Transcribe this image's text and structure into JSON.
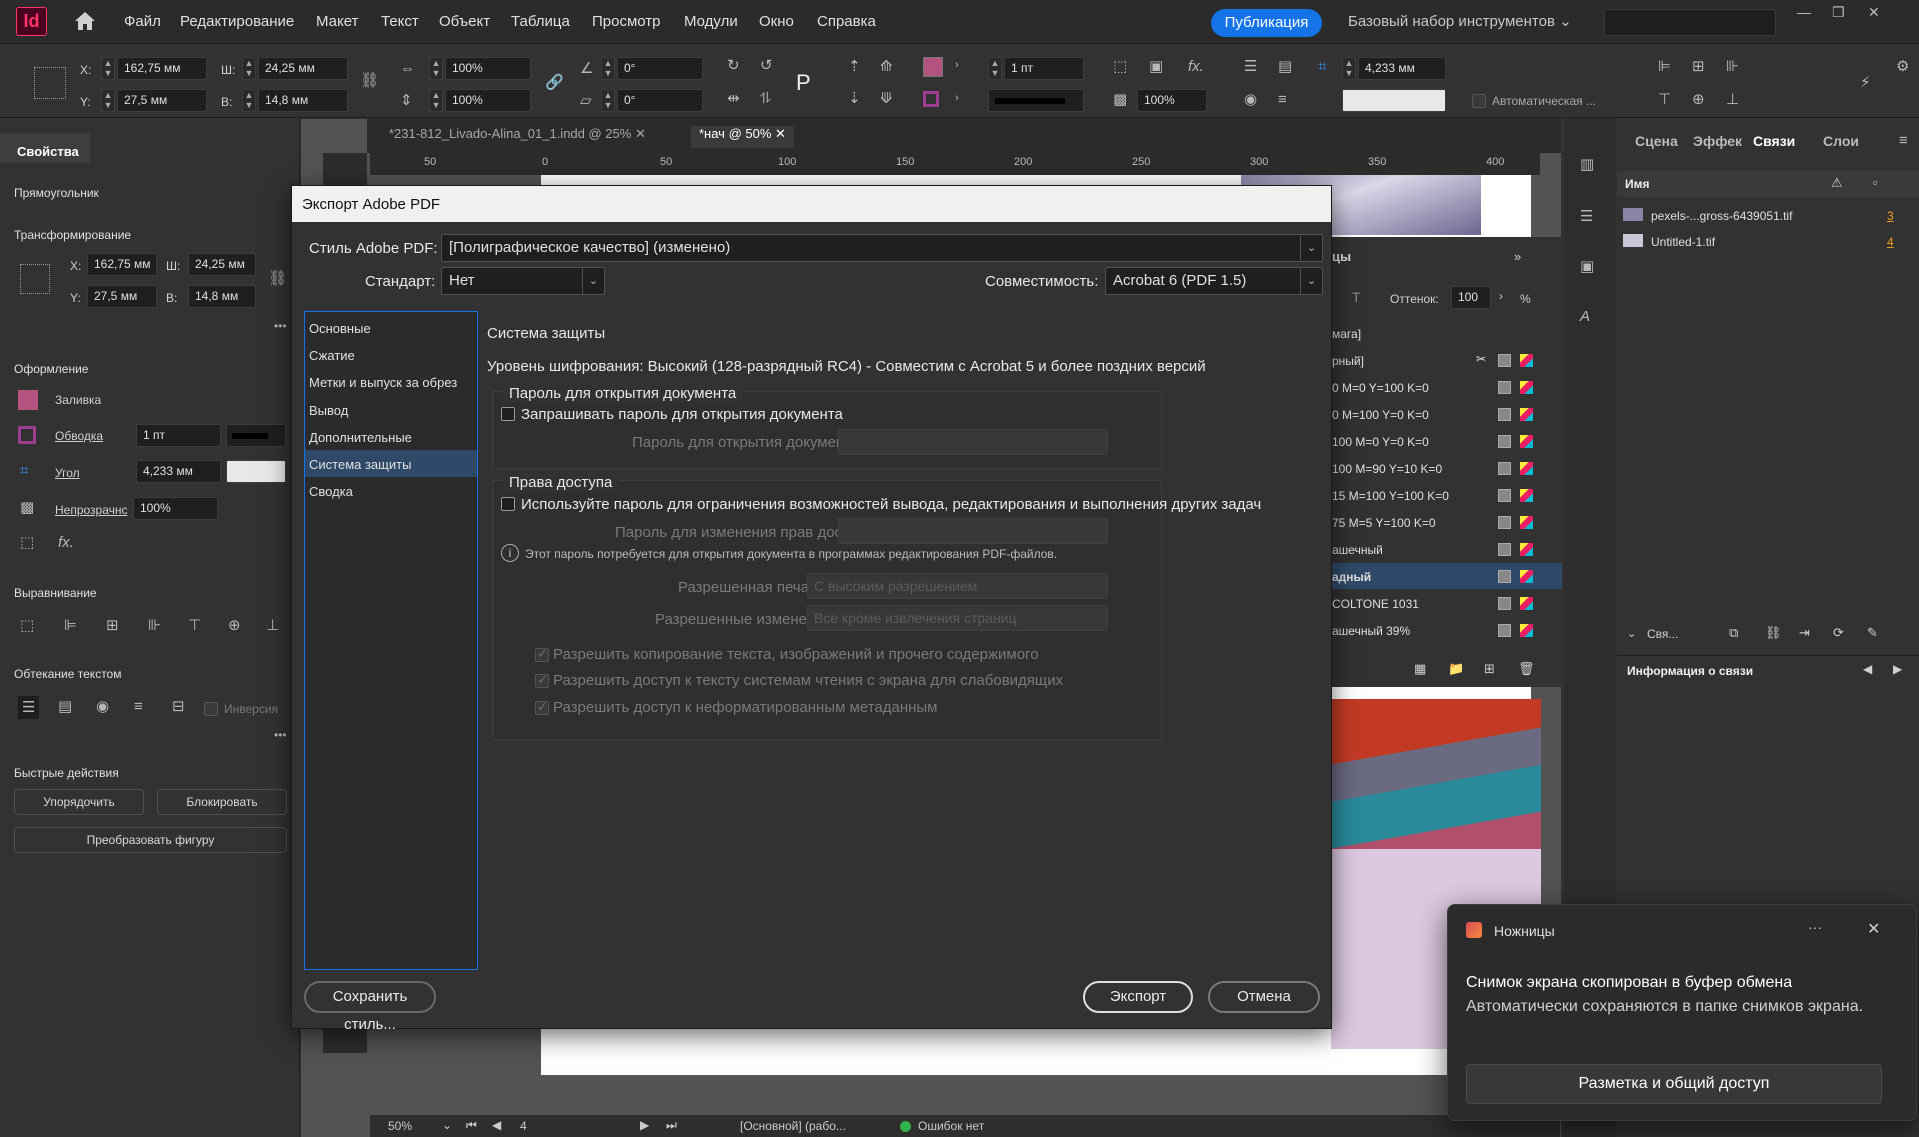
{
  "menubar": {
    "logo": "Id",
    "items": [
      "Файл",
      "Редактирование",
      "Макет",
      "Текст",
      "Объект",
      "Таблица",
      "Просмотр",
      "Модули",
      "Окно",
      "Справка"
    ],
    "publish": "Публикация",
    "workspace": "Базовый набор инструментов"
  },
  "control": {
    "x_label": "X:",
    "x": "162,75 мм",
    "y_label": "Y:",
    "y": "27,5 мм",
    "w_label": "Ш:",
    "w": "24,25 мм",
    "h_label": "В:",
    "h": "14,8 мм",
    "scale_x": "100%",
    "scale_y": "100%",
    "rotate": "0°",
    "shear": "0°",
    "stroke_weight": "1 пт",
    "opacity": "100%",
    "offset": "4,233 мм",
    "auto_label": "Автоматическая ..."
  },
  "left_panel": {
    "tab": "Свойства",
    "object_type": "Прямоугольник",
    "transform_title": "Трансформирование",
    "x_label": "X:",
    "x": "162,75 мм",
    "y_label": "Y:",
    "y": "27,5 мм",
    "w_label": "Ш:",
    "w": "24,25 мм",
    "h_label": "В:",
    "h": "14,8 мм",
    "appearance_title": "Оформление",
    "fill_label": "Заливка",
    "stroke_label": "Обводка",
    "stroke_weight": "1 пт",
    "corner_label": "Угол",
    "corner_value": "4,233 мм",
    "opacity_label": "Непрозрачнс",
    "opacity_value": "100%",
    "align_title": "Выравнивание",
    "wrap_title": "Обтекание текстом",
    "invert_label": "Инверсия",
    "quick_title": "Быстрые действия",
    "arrange_btn": "Упорядочить",
    "lock_btn": "Блокировать",
    "convert_btn": "Преобразовать фигуру",
    "fill_color": "#b3537f",
    "stroke_color": "#9b3e8f"
  },
  "tabs": [
    {
      "label": "*231-812_Livado-Alina_01_1.indd @ 25%"
    },
    {
      "label": "*нач @ 50%"
    }
  ],
  "ruler": [
    "50",
    "0",
    "50",
    "100",
    "150",
    "200",
    "250",
    "300",
    "350",
    "400"
  ],
  "swatches": {
    "tab": "цы",
    "tint_label": "Оттенок:",
    "tint": "100",
    "pct": "%",
    "rows": [
      "мага]",
      "рный]",
      "0 M=0 Y=100 K=0",
      "0 M=100 Y=0 K=0",
      "100 M=0 Y=0 K=0",
      "100 M=90 Y=10 K=0",
      "15 M=100 Y=100 K=0",
      "75 M=5 Y=100 K=0",
      "ашечный",
      "адный",
      "COLTONE 1031",
      "ашечный 39%"
    ]
  },
  "right_panel": {
    "tabs": [
      "Сцена",
      "Эффек",
      "Связи",
      "Слои"
    ],
    "col_name": "Имя",
    "links": [
      {
        "name": "pexels-...gross-6439051.tif",
        "page": "3"
      },
      {
        "name": "Untitled-1.tif",
        "page": "4"
      }
    ],
    "footer_label": "Свя...",
    "info_label": "Информация о связи"
  },
  "status": {
    "zoom": "50%",
    "page": "4",
    "master": "[Основной] (рабо...",
    "errors": "Ошибок нет"
  },
  "dialog": {
    "title": "Экспорт Adobe PDF",
    "style_label": "Стиль Adobe PDF:",
    "style_value": "[Полиграфическое качество] (изменено)",
    "standard_label": "Стандарт:",
    "standard_value": "Нет",
    "compat_label": "Совместимость:",
    "compat_value": "Acrobat 6 (PDF 1.5)",
    "categories": [
      "Основные",
      "Сжатие",
      "Метки и выпуск за обрез",
      "Вывод",
      "Дополнительные",
      "Система защиты",
      "Сводка"
    ],
    "selected_index": 5,
    "section_title": "Система защиты",
    "encryption": "Уровень шифрования: Высокий (128-разрядный RC4) - Совместим с Acrobat 5 и более поздних версий",
    "open_pw_group": "Пароль для открытия документа",
    "open_pw_check": "Запрашивать пароль для открытия документа",
    "open_pw_label": "Пароль для открытия документа:",
    "perm_group": "Права доступа",
    "perm_check": "Используйте пароль для ограничения возможностей вывода, редактирования и выполнения других задач",
    "perm_pw_label": "Пароль для изменения прав доступа:",
    "info_note": "Этот пароль потребуется для открытия документа в программах редактирования PDF-файлов.",
    "print_label": "Разрешенная печать:",
    "print_value": "С высоким разрешением",
    "changes_label": "Разрешенные изменения:",
    "changes_value": "Все кроме извлечения страниц",
    "allow_copy": "Разрешить копирование текста, изображений и прочего содержимого",
    "allow_reader": "Разрешить доступ к тексту системам чтения с экрана для слабовидящих",
    "allow_meta": "Разрешить доступ к неформатированным метаданным",
    "save_style": "Сохранить стиль...",
    "export": "Экспорт",
    "cancel": "Отмена"
  },
  "toast": {
    "app": "Ножницы",
    "message": "Снимок экрана скопирован в буфер обмена",
    "sub": "Автоматически сохраняются в папке снимков экрана.",
    "action": "Разметка и общий доступ",
    "more": "···"
  }
}
